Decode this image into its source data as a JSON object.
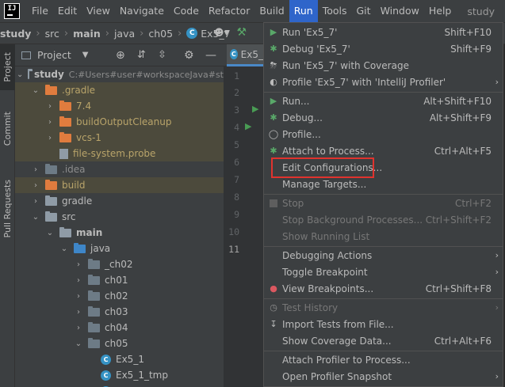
{
  "menubar": {
    "logo": "IJ",
    "items": [
      "File",
      "Edit",
      "View",
      "Navigate",
      "Code",
      "Refactor",
      "Build",
      "Run",
      "Tools",
      "Git",
      "Window",
      "Help"
    ],
    "active_index": 7,
    "project_title": "study"
  },
  "breadcrumb": {
    "items": [
      "study",
      "src",
      "main",
      "java",
      "ch05",
      "Ex5_7"
    ]
  },
  "left_tabs": [
    "Project",
    "Commit",
    "Pull Requests"
  ],
  "project_panel": {
    "title": "Project",
    "tree": [
      {
        "label": "study",
        "extra": "C:#Users#user#workspaceJava#st",
        "bold": true
      },
      {
        "label": ".gradle"
      },
      {
        "label": "7.4"
      },
      {
        "label": "buildOutputCleanup"
      },
      {
        "label": "vcs-1"
      },
      {
        "label": "file-system.probe"
      },
      {
        "label": ".idea"
      },
      {
        "label": "build"
      },
      {
        "label": "gradle"
      },
      {
        "label": "src"
      },
      {
        "label": "main",
        "bold": true
      },
      {
        "label": "java"
      },
      {
        "label": "_ch02"
      },
      {
        "label": "ch01"
      },
      {
        "label": "ch02"
      },
      {
        "label": "ch03"
      },
      {
        "label": "ch04"
      },
      {
        "label": "ch05"
      },
      {
        "label": "Ex5_1"
      },
      {
        "label": "Ex5_1_tmp"
      }
    ]
  },
  "editor": {
    "tab_label": "Ex5_",
    "line_numbers": [
      "1",
      "2",
      "3",
      "4",
      "5",
      "6",
      "7",
      "8",
      "9",
      "10",
      "11"
    ]
  },
  "run_menu": {
    "items": [
      {
        "label": "Run 'Ex5_7'",
        "shortcut": "Shift+F10",
        "icon": "run-icon"
      },
      {
        "label": "Debug 'Ex5_7'",
        "shortcut": "Shift+F9",
        "icon": "debug-icon"
      },
      {
        "label": "Run 'Ex5_7' with Coverage",
        "shortcut": "",
        "icon": "coverage-icon"
      },
      {
        "label": "Profile 'Ex5_7' with 'IntelliJ Profiler'",
        "shortcut": "",
        "icon": "profiler-icon"
      },
      {
        "label": "Run...",
        "shortcut": "Alt+Shift+F10",
        "icon": "run-icon"
      },
      {
        "label": "Debug...",
        "shortcut": "Alt+Shift+F9",
        "icon": "debug-icon"
      },
      {
        "label": "Profile...",
        "shortcut": "",
        "icon": "profile-icon"
      },
      {
        "label": "Attach to Process...",
        "shortcut": "Ctrl+Alt+F5",
        "icon": "attach-icon"
      },
      {
        "label": "Edit Configurations...",
        "shortcut": "",
        "icon": ""
      },
      {
        "label": "Manage Targets...",
        "shortcut": "",
        "icon": ""
      },
      {
        "label": "Stop",
        "shortcut": "Ctrl+F2",
        "icon": "stop-icon"
      },
      {
        "label": "Stop Background Processes...",
        "shortcut": "Ctrl+Shift+F2",
        "icon": ""
      },
      {
        "label": "Show Running List",
        "shortcut": "",
        "icon": ""
      },
      {
        "label": "Debugging Actions",
        "shortcut": "",
        "icon": ""
      },
      {
        "label": "Toggle Breakpoint",
        "shortcut": "",
        "icon": ""
      },
      {
        "label": "View Breakpoints...",
        "shortcut": "Ctrl+Shift+F8",
        "icon": "breakpoints-icon"
      },
      {
        "label": "Test History",
        "shortcut": "",
        "icon": "history-icon"
      },
      {
        "label": "Import Tests from File...",
        "shortcut": "",
        "icon": "import-icon"
      },
      {
        "label": "Show Coverage Data...",
        "shortcut": "Ctrl+Alt+F6",
        "icon": ""
      },
      {
        "label": "Attach Profiler to Process...",
        "shortcut": "",
        "icon": ""
      },
      {
        "label": "Open Profiler Snapshot",
        "shortcut": "",
        "icon": ""
      }
    ]
  },
  "colors": {
    "accent": "#2f65ca",
    "highlight_box": "#e0332e",
    "run_green": "#59a869"
  }
}
